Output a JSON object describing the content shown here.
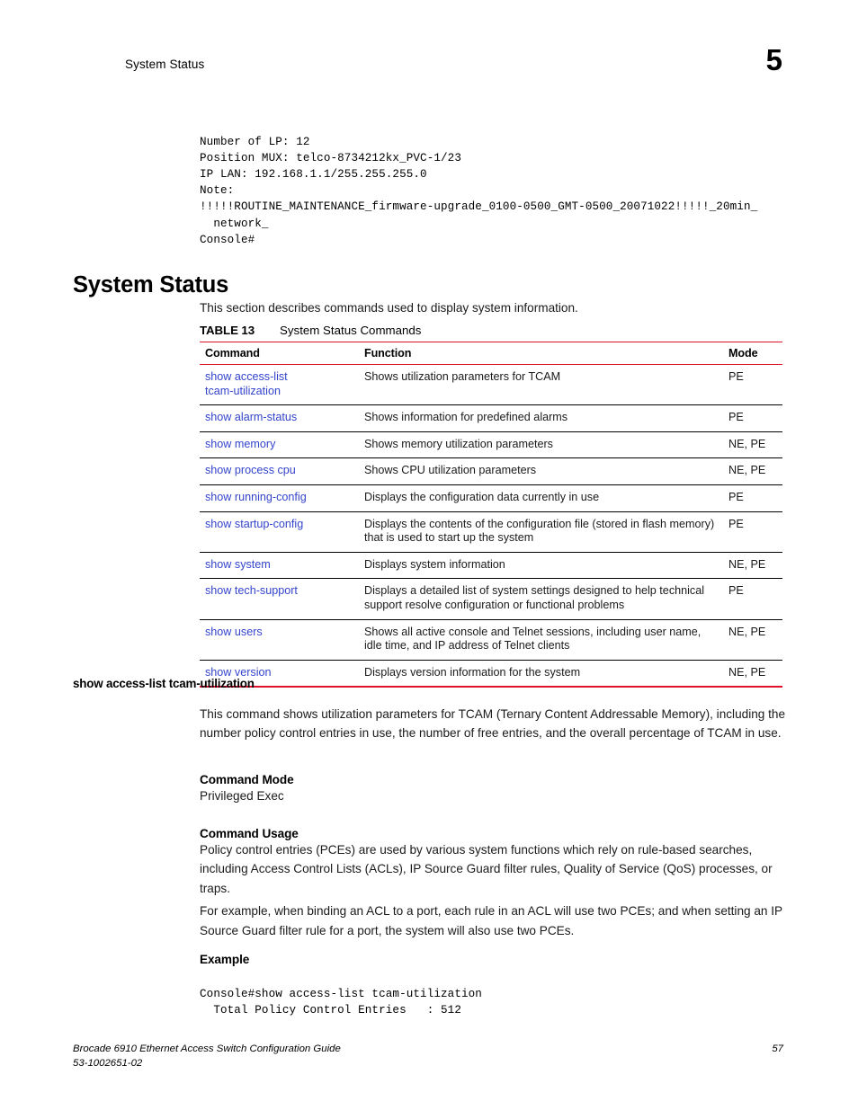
{
  "header": {
    "running_head": "System Status",
    "chapter_number": "5"
  },
  "top_code": "Number of LP: 12\nPosition MUX: telco-8734212kx_PVC-1/23\nIP LAN: 192.168.1.1/255.255.255.0\nNote:\n!!!!!ROUTINE_MAINTENANCE_firmware-upgrade_0100-0500_GMT-0500_20071022!!!!!_20min_\n  network_\nConsole#",
  "section": {
    "title": "System Status",
    "intro": "This section describes commands used to display system information."
  },
  "table": {
    "label": "TABLE 13",
    "name": "System Status Commands",
    "columns": [
      "Command",
      "Function",
      "Mode"
    ],
    "rows": [
      {
        "command": "show access-list tcam-utilization",
        "command_lines": [
          "show access-list",
          "tcam-utilization"
        ],
        "function": "Shows utilization parameters for TCAM",
        "mode": "PE"
      },
      {
        "command": "show alarm-status",
        "command_lines": [
          "show alarm-status"
        ],
        "function": "Shows information for predefined alarms",
        "mode": "PE"
      },
      {
        "command": "show memory",
        "command_lines": [
          "show memory"
        ],
        "function": "Shows memory utilization parameters",
        "mode": "NE, PE"
      },
      {
        "command": "show process cpu",
        "command_lines": [
          "show process cpu"
        ],
        "function": "Shows CPU utilization parameters",
        "mode": "NE, PE"
      },
      {
        "command": "show running-config",
        "command_lines": [
          "show running-config"
        ],
        "function": "Displays the configuration data currently in use",
        "mode": "PE"
      },
      {
        "command": "show startup-config",
        "command_lines": [
          "show startup-config"
        ],
        "function": "Displays the contents of the configuration file (stored in flash memory) that is used to start up the system",
        "mode": "PE"
      },
      {
        "command": "show system",
        "command_lines": [
          "show system"
        ],
        "function": "Displays system information",
        "mode": "NE, PE"
      },
      {
        "command": "show tech-support",
        "command_lines": [
          "show tech-support"
        ],
        "function": "Displays a detailed list of system settings designed to help technical support resolve configuration or functional problems",
        "mode": "PE"
      },
      {
        "command": "show users",
        "command_lines": [
          "show users"
        ],
        "function": "Shows all active console and Telnet sessions, including user name, idle time, and IP address of Telnet clients",
        "mode": "NE, PE"
      },
      {
        "command": "show version",
        "command_lines": [
          "show version"
        ],
        "function": "Displays version information for the system",
        "mode": "NE, PE"
      }
    ]
  },
  "command_section": {
    "heading": "show access-list tcam-utilization",
    "description": "This command shows utilization parameters for TCAM (Ternary Content Addressable Memory), including the number policy control entries in use, the number of free entries, and the overall percentage of TCAM in use.",
    "mode_heading": "Command Mode",
    "mode_value": "Privileged Exec",
    "usage_heading": "Command Usage",
    "usage_para1": "Policy control entries (PCEs) are used by various system functions which rely on rule-based searches, including Access Control Lists (ACLs), IP Source Guard filter rules, Quality of Service (QoS) processes, or traps.",
    "usage_para2": "For example, when binding an ACL to a port, each rule in an ACL will use two PCEs; and when setting an IP Source Guard filter rule for a port, the system will also use two PCEs.",
    "example_heading": "Example",
    "example_code": "Console#show access-list tcam-utilization\n  Total Policy Control Entries   : 512"
  },
  "footer": {
    "title": "Brocade 6910 Ethernet Access Switch Configuration Guide",
    "doc_number": "53-1002651-02",
    "page_number": "57"
  },
  "colors": {
    "rule_red": "#e0112b",
    "link_blue": "#3344cc",
    "text_black": "#1a1a1a"
  }
}
